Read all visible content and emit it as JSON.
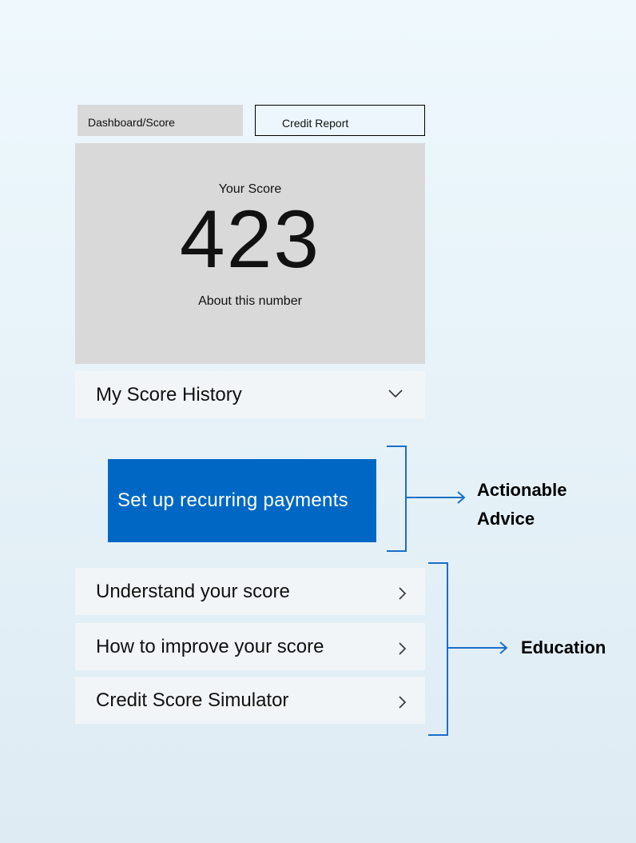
{
  "tabs": {
    "dashboard": "Dashboard/Score",
    "credit_report": "Credit Report"
  },
  "score_card": {
    "label": "Your Score",
    "value": "423",
    "about_link": "About this number"
  },
  "history": {
    "label": "My Score History",
    "icon": "chevron-down-icon"
  },
  "action": {
    "button_label": "Set up recurring payments",
    "color": "#0068c4"
  },
  "education": {
    "items": [
      {
        "label": "Understand your score",
        "icon": "chevron-right-icon"
      },
      {
        "label": "How to improve your score",
        "icon": "chevron-right-icon"
      },
      {
        "label": "Credit Score Simulator",
        "icon": "chevron-right-icon"
      }
    ]
  },
  "annotations": {
    "actionable_line1": "Actionable",
    "actionable_line2": "Advice",
    "education": "Education",
    "color": "#1a6fc7"
  }
}
